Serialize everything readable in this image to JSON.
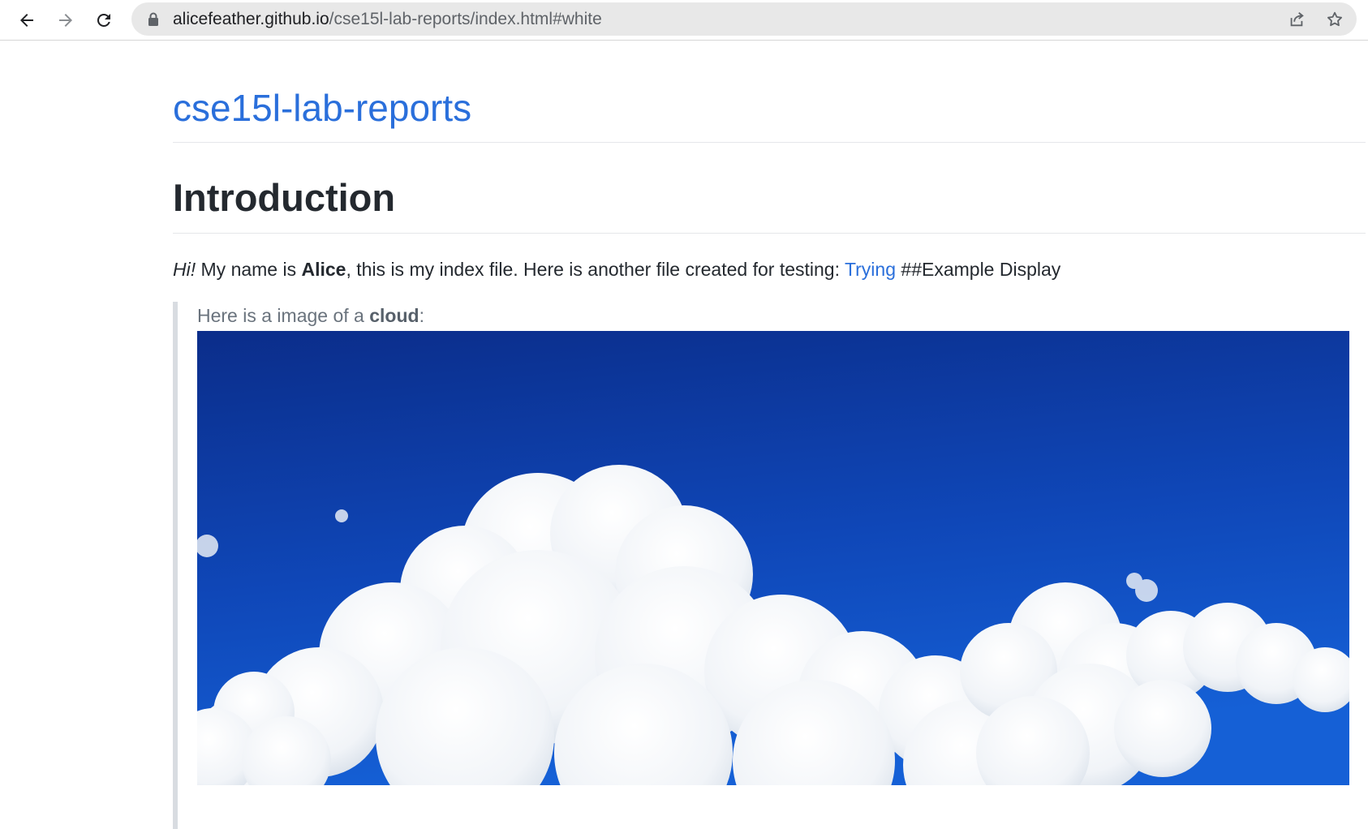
{
  "browser": {
    "url_host": "alicefeather.github.io",
    "url_path": "/cse15l-lab-reports/index.html#white"
  },
  "page": {
    "site_title": "cse15l-lab-reports",
    "heading": "Introduction",
    "intro": {
      "hi": "Hi!",
      "text1": " My name is ",
      "name": "Alice",
      "text2": ", this is my index file. Here is another file created for testing: ",
      "link": "Trying",
      "text3": " ##Example Display"
    },
    "quote": {
      "text1": "Here is a image of a ",
      "bold": "cloud",
      "text2": ":"
    }
  },
  "colors": {
    "link": "#2a6fdb",
    "sky_top": "#0b2d8a",
    "sky_bottom": "#1560d6"
  }
}
